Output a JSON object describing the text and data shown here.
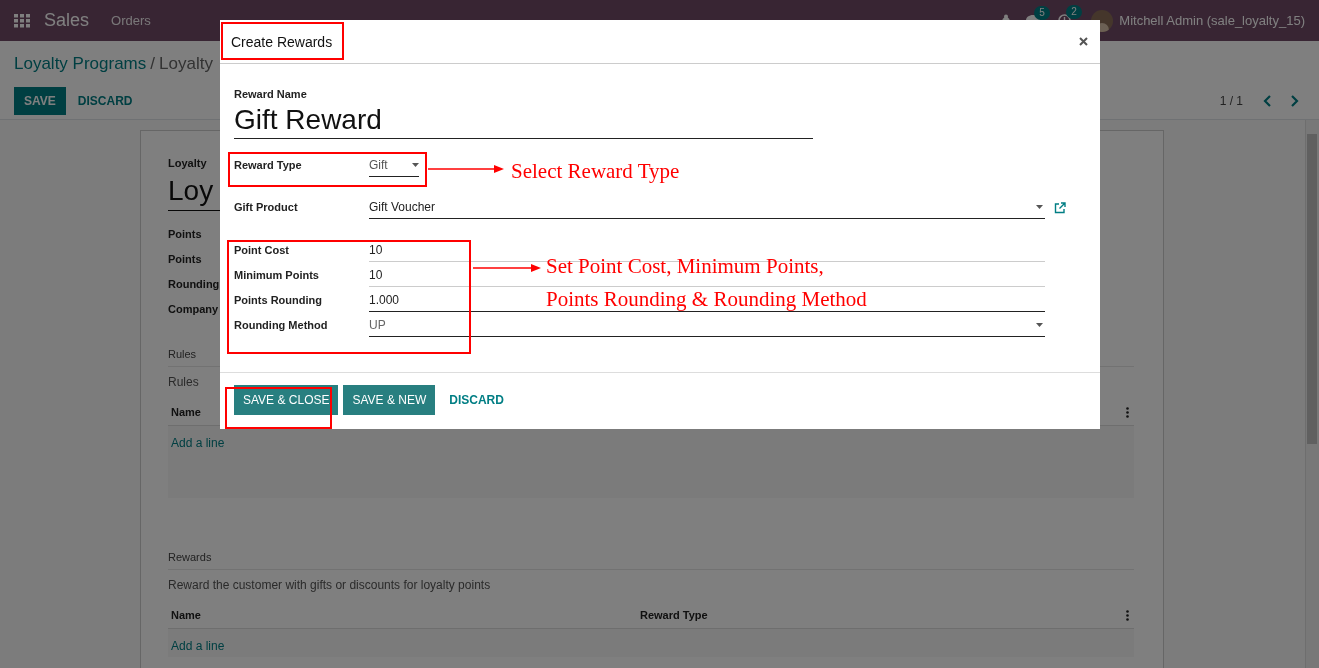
{
  "navbar": {
    "app": "Sales",
    "menu": [
      "Orders"
    ],
    "badges": [
      "5",
      "2"
    ],
    "user": "Mitchell Admin (sale_loyalty_15)"
  },
  "breadcrumb": {
    "parent": "Loyalty Programs",
    "separator": "/",
    "current": "Loyalty"
  },
  "actions": [
    {
      "label": "SAVE",
      "primary": true
    },
    {
      "label": "DISCARD",
      "primary": false
    }
  ],
  "pager": "1 / 1",
  "form": {
    "label": "Loyalty",
    "title": "Loy",
    "fields": [
      "Points",
      "Points",
      "Rounding",
      "Company"
    ],
    "sections": [
      {
        "title": "Rules",
        "description": "Rules",
        "columns": [
          "Name"
        ],
        "add_line": "Add a line",
        "tall": true
      },
      {
        "title": "Rewards",
        "description": "Reward the customer with gifts or discounts for loyalty points",
        "columns": [
          "Name",
          "Reward Type"
        ],
        "add_line": "Add a line",
        "tall": false
      }
    ]
  },
  "dialog": {
    "title": "Create Rewards",
    "name_label": "Reward Name",
    "name_value": "Gift Reward",
    "fields": [
      {
        "label": "Reward Type",
        "value": "Gift",
        "kind": "select-short"
      },
      {
        "label": "Gift Product",
        "value": "Gift Voucher",
        "kind": "many2one"
      },
      {
        "label": "Point Cost",
        "value": "10",
        "kind": "input"
      },
      {
        "label": "Minimum Points",
        "value": "10",
        "kind": "input"
      },
      {
        "label": "Points Rounding",
        "value": "1.000",
        "kind": "input"
      },
      {
        "label": "Rounding Method",
        "value": "UP",
        "kind": "select"
      }
    ],
    "buttons": [
      {
        "label": "SAVE & CLOSE",
        "primary": true
      },
      {
        "label": "SAVE & NEW",
        "primary": true
      },
      {
        "label": "DISCARD",
        "primary": false
      }
    ]
  },
  "annotations": [
    {
      "lines": [
        "Select Reward Type"
      ]
    },
    {
      "lines": [
        "Set Point Cost, Minimum Points,",
        "Points Rounding & Rounding Method"
      ]
    }
  ]
}
